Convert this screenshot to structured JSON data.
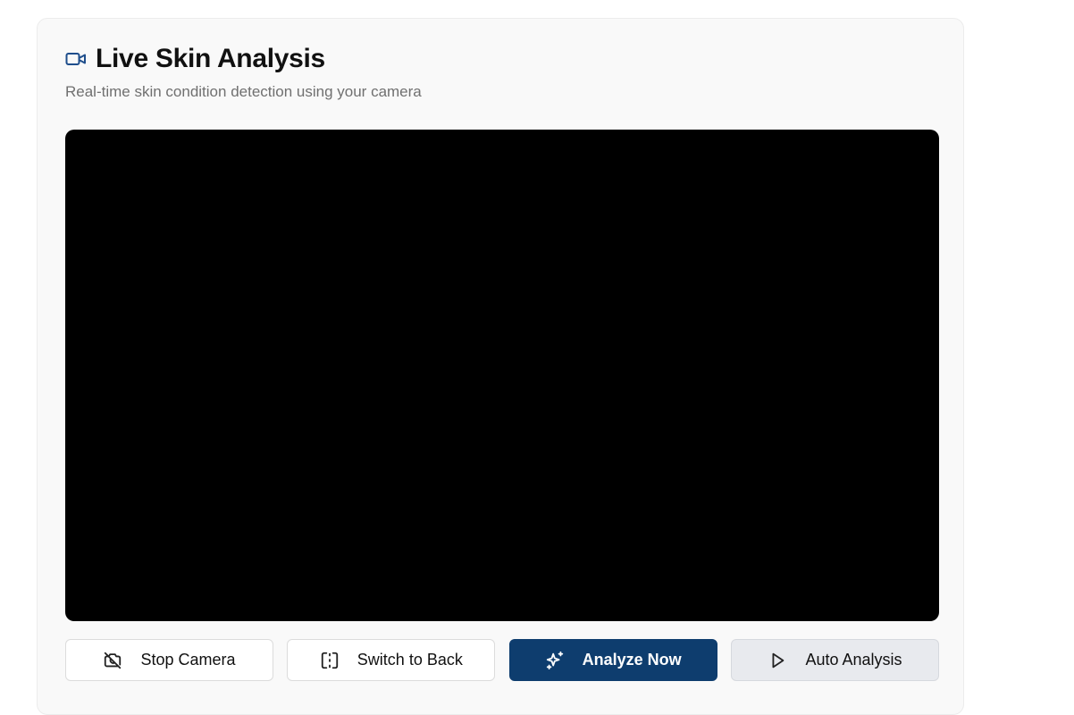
{
  "header": {
    "title": "Live Skin Analysis",
    "subtitle": "Real-time skin condition detection using your camera",
    "icon": "video-camera-icon"
  },
  "controls": {
    "stop_camera_label": "Stop Camera",
    "switch_camera_label": "Switch to Back",
    "analyze_label": "Analyze Now",
    "auto_analysis_label": "Auto Analysis"
  },
  "icons": {
    "stop_camera": "camera-off-icon",
    "switch_camera": "switch-camera-icon",
    "analyze": "sparkles-icon",
    "auto_analysis": "play-icon"
  },
  "colors": {
    "primary": "#0e3d6e",
    "title_icon": "#1f4e8c",
    "video_bg": "#000000"
  }
}
